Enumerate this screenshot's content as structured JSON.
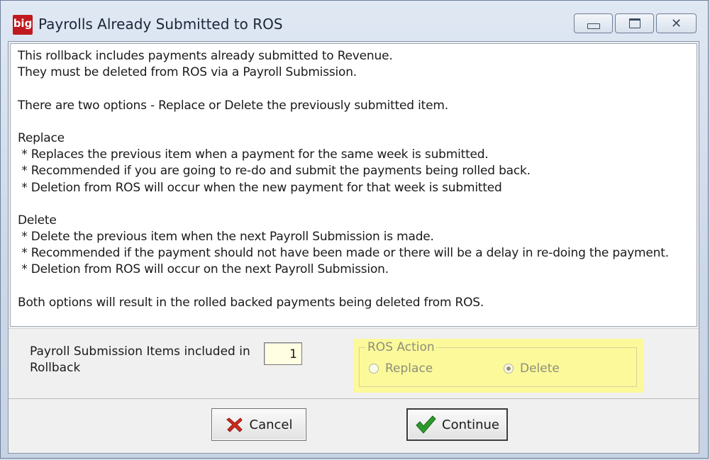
{
  "window": {
    "title": "Payrolls Already Submitted to ROS",
    "app_icon_text": "big"
  },
  "message": {
    "lines": [
      "This rollback includes payments already submitted to Revenue.",
      "They must be deleted from ROS via a Payroll Submission.",
      "",
      "There are two options - Replace or Delete the previously submitted item.",
      "",
      "Replace",
      " * Replaces the previous item when a payment for the same week is submitted.",
      " * Recommended if you are going to re-do and submit the payments being rolled back.",
      " * Deletion from ROS will occur when the new payment for that week is submitted",
      "",
      "Delete",
      " * Delete the previous item when the next Payroll Submission is made.",
      " * Recommended if the payment should not have been made or there will be a delay in re-doing the payment.",
      " * Deletion from ROS will occur on the next Payroll Submission.",
      "",
      "Both options will result in the rolled backed payments being deleted from ROS."
    ]
  },
  "items": {
    "label": "Payroll Submission Items included in Rollback",
    "value": "1"
  },
  "ros_action": {
    "legend": "ROS Action",
    "options": [
      "Replace",
      "Delete"
    ],
    "selected": "Delete",
    "highlight_color": "#fbf99a"
  },
  "buttons": {
    "cancel_label": "Cancel",
    "continue_label": "Continue"
  }
}
